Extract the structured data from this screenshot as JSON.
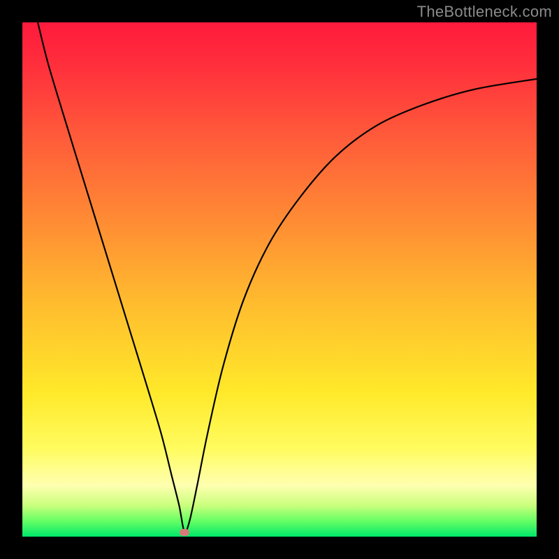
{
  "watermark": "TheBottleneck.com",
  "chart_data": {
    "type": "line",
    "title": "",
    "xlabel": "",
    "ylabel": "",
    "xlim": [
      0,
      100
    ],
    "ylim": [
      0,
      100
    ],
    "grid": false,
    "legend": false,
    "series": [
      {
        "name": "curve",
        "x": [
          3,
          5,
          8,
          12,
          16,
          20,
          24,
          27,
          29,
          30.5,
          31.5,
          32.5,
          34,
          36,
          39,
          43,
          48,
          54,
          61,
          69,
          78,
          88,
          100
        ],
        "y": [
          100,
          92,
          82,
          69,
          56,
          43,
          30,
          20,
          12,
          6,
          1,
          3,
          10,
          20,
          33,
          46,
          57,
          66,
          74,
          80,
          84,
          87,
          89
        ]
      }
    ],
    "marker": {
      "x": 31.5,
      "y": 0.8
    },
    "colors": {
      "curve": "#000000",
      "marker": "#d77a7a",
      "gradient_top": "#ff1a3c",
      "gradient_bottom": "#00e66a",
      "background": "#000000"
    }
  }
}
